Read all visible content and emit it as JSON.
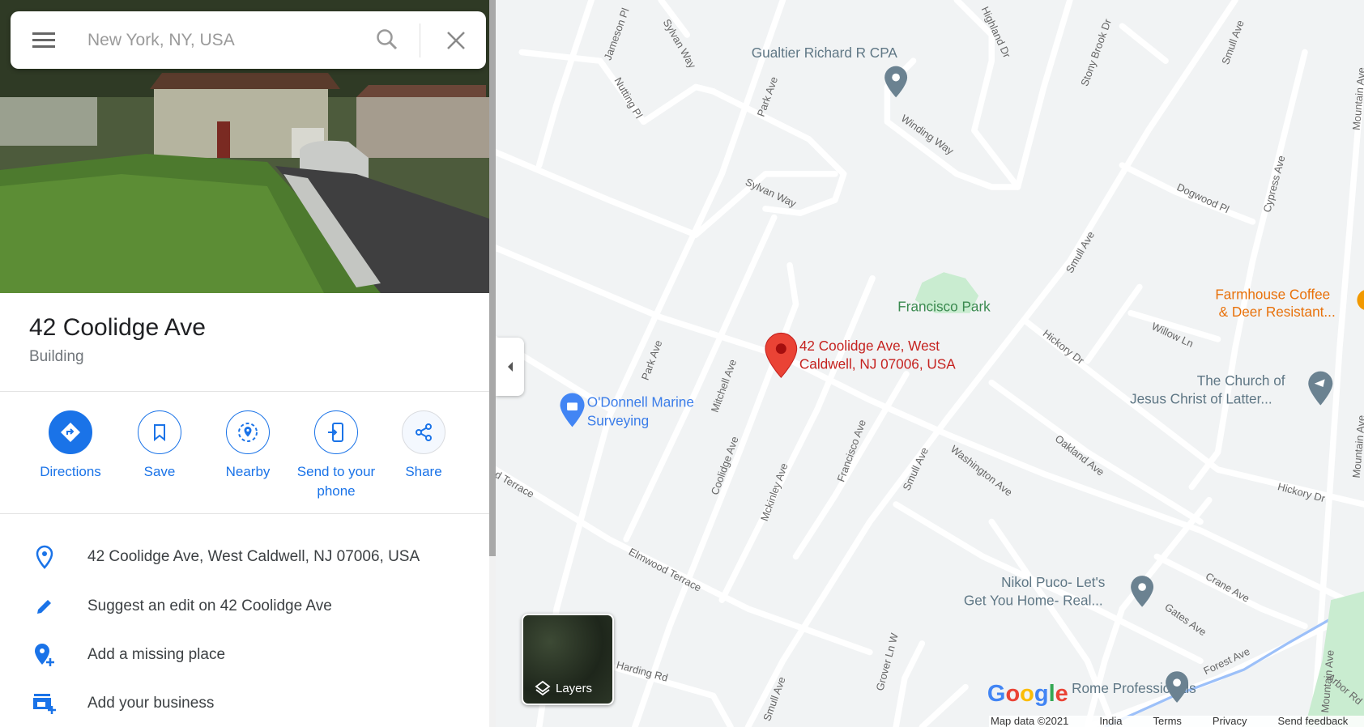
{
  "search": {
    "placeholder": "New York, NY, USA"
  },
  "place": {
    "title": "42 Coolidge Ave",
    "category": "Building"
  },
  "actions": [
    {
      "label": "Directions",
      "icon": "directions-icon"
    },
    {
      "label": "Save",
      "icon": "bookmark-icon"
    },
    {
      "label": "Nearby",
      "icon": "nearby-icon"
    },
    {
      "label": "Send to your phone",
      "icon": "send-to-phone-icon"
    },
    {
      "label": "Share",
      "icon": "share-icon"
    }
  ],
  "info_rows": [
    {
      "label": "42 Coolidge Ave, West Caldwell, NJ 07006, USA",
      "icon": "location-pin-icon"
    },
    {
      "label": "Suggest an edit on 42 Coolidge Ave",
      "icon": "pencil-icon"
    },
    {
      "label": "Add a missing place",
      "icon": "add-place-icon"
    },
    {
      "label": "Add your business",
      "icon": "add-business-icon"
    }
  ],
  "map": {
    "pin_label_1": "42 Coolidge Ave, West",
    "pin_label_2": "Caldwell, NJ 07006, USA",
    "pois": {
      "gualtier": "Gualtier Richard R CPA",
      "park": "Francisco Park",
      "farmhouse_1": "Farmhouse Coffee",
      "farmhouse_2": "& Deer Resistant...",
      "church_1": "The Church of",
      "church_2": "Jesus Christ of Latter...",
      "odonnell_1": "O'Donnell Marine",
      "odonnell_2": "Surveying",
      "nikol_1": "Nikol Puco- Let's",
      "nikol_2": "Get You Home- Real...",
      "rome": "Rome Professionals"
    },
    "streets": {
      "jameson": "Jameson Pl",
      "sylvan1": "Sylvan Way",
      "sylvan2": "Sylvan Way",
      "nutting": "Nutting Pl",
      "park1": "Park Ave",
      "park2": "Park Ave",
      "highland": "Highland Dr",
      "stony": "Stony Brook Dr",
      "smull1": "Smull Ave",
      "smull2": "Smull Ave",
      "smull3": "Smull Ave",
      "smull4": "Smull Ave",
      "winding": "Winding Way",
      "dogwood": "Dogwood Pl",
      "cypress": "Cypress Ave",
      "mountain1": "Mountain Ave",
      "mountain2": "Mountain Ave",
      "mountain3": "Mountain Ave",
      "mitchell": "Mitchell Ave",
      "coolidge": "Coolidge Ave",
      "mckinley": "Mckinley Ave",
      "francisco": "Francisco Ave",
      "washington": "Washington Ave",
      "hickory1": "Hickory Dr",
      "hickory2": "Hickory Dr",
      "willow": "Willow Ln",
      "oakland": "Oakland Ave",
      "terrace": "d Terrace",
      "elmwood": "Elmwood Terrace",
      "crane": "Crane Ave",
      "gates": "Gates Ave",
      "forest": "Forest Ave",
      "arbor": "Arbor Rd",
      "grover": "Grover Ln W",
      "harding": "Harding Rd"
    },
    "layers_label": "Layers",
    "colors": {
      "pin": "#ea4335",
      "poi_gray": "#6b8291",
      "poi_blue": "#4285f4",
      "park": "#c9ecd0",
      "park_text": "#3a8a4f",
      "poi_orange": "#e8710a",
      "road": "#ffffff",
      "background": "#f1f3f4"
    }
  },
  "footer": {
    "map_data": "Map data ©2021",
    "region": "India",
    "terms": "Terms",
    "privacy": "Privacy",
    "feedback": "Send feedback",
    "scale": "20"
  },
  "accent": "#1a73e8"
}
